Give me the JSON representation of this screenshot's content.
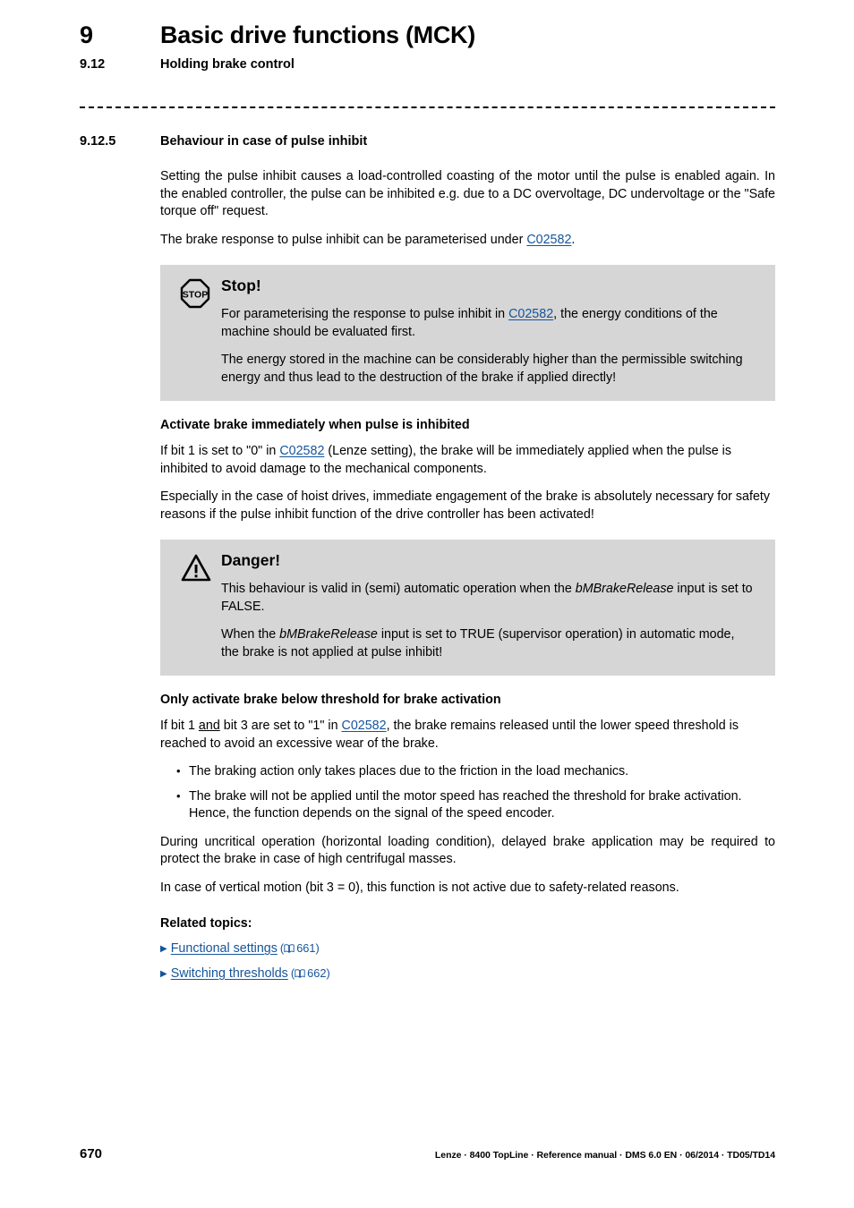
{
  "header": {
    "chapter_number": "9",
    "chapter_title": "Basic drive functions (MCK)",
    "section_number": "9.12",
    "section_title": "Holding brake control"
  },
  "subsection": {
    "number": "9.12.5",
    "title": "Behaviour in case of pulse inhibit"
  },
  "intro": {
    "paragraph1": "Setting the pulse inhibit causes a load-controlled coasting of the motor until the pulse is enabled again. In the enabled controller, the pulse can be inhibited e.g. due to a DC overvoltage, DC undervoltage or the \"Safe torque off\" request.",
    "paragraph2_pre": "The brake response to pulse inhibit can be parameterised under ",
    "paragraph2_link": "C02582",
    "paragraph2_post": "."
  },
  "stop_callout": {
    "icon": "stop-octagon-icon",
    "title": "Stop!",
    "paragraph1_pre": "For parameterising the response to pulse inhibit in ",
    "paragraph1_link": "C02582",
    "paragraph1_post": ", the energy conditions of the machine should be evaluated first.",
    "paragraph2": "The energy stored in the machine can be considerably higher than the permissible switching energy and thus lead to the destruction of the brake if applied directly!"
  },
  "section_immediate": {
    "heading": "Activate brake immediately when pulse is inhibited",
    "paragraph1_pre": "If bit 1 is set to \"0\" in ",
    "paragraph1_link": "C02582",
    "paragraph1_post": " (Lenze setting), the brake will be immediately applied when the pulse is inhibited to avoid damage to the mechanical components.",
    "paragraph2": "Especially in the case of hoist drives, immediate engagement of the brake is absolutely necessary for safety reasons if the pulse inhibit function of the drive controller has been activated!"
  },
  "danger_callout": {
    "icon": "warning-triangle-icon",
    "title": "Danger!",
    "paragraph1_pre": "This behaviour is valid in (semi) automatic operation when the ",
    "paragraph1_italic": "bMBrakeRelease",
    "paragraph1_post": " input is set to FALSE.",
    "paragraph2_pre": "When the ",
    "paragraph2_italic": "bMBrakeRelease",
    "paragraph2_post": " input is set to TRUE (supervisor operation) in automatic mode, the brake is not applied at pulse inhibit!"
  },
  "section_threshold": {
    "heading": "Only activate brake below threshold for brake activation",
    "paragraph1_pre": "If bit 1 ",
    "paragraph1_underline": "and",
    "paragraph1_mid": " bit 3 are set to \"1\" in ",
    "paragraph1_link": "C02582",
    "paragraph1_post": ", the brake remains released until the lower speed threshold is reached to avoid an excessive wear of the brake.",
    "bullets": [
      "The braking action only takes places due to the friction in the load mechanics.",
      "The brake will not be applied until the motor speed has reached the threshold for brake activation. Hence, the function depends on the signal of the speed encoder."
    ],
    "paragraph2": "During uncritical operation (horizontal loading condition), delayed brake application may be required to protect the brake in case of high centrifugal masses.",
    "paragraph3": "In case of vertical motion (bit 3 = 0), this function is not active due to safety-related reasons."
  },
  "related_topics": {
    "heading": "Related topics:",
    "items": [
      {
        "label": "Functional settings",
        "page_ref": "661"
      },
      {
        "label": "Switching thresholds",
        "page_ref": "662"
      }
    ]
  },
  "footer": {
    "page_number": "670",
    "note": "Lenze · 8400 TopLine · Reference manual · DMS 6.0 EN · 06/2014 · TD05/TD14"
  },
  "colors": {
    "link": "#14549b",
    "callout_background": "#d6d6d6",
    "text": "#000000"
  }
}
